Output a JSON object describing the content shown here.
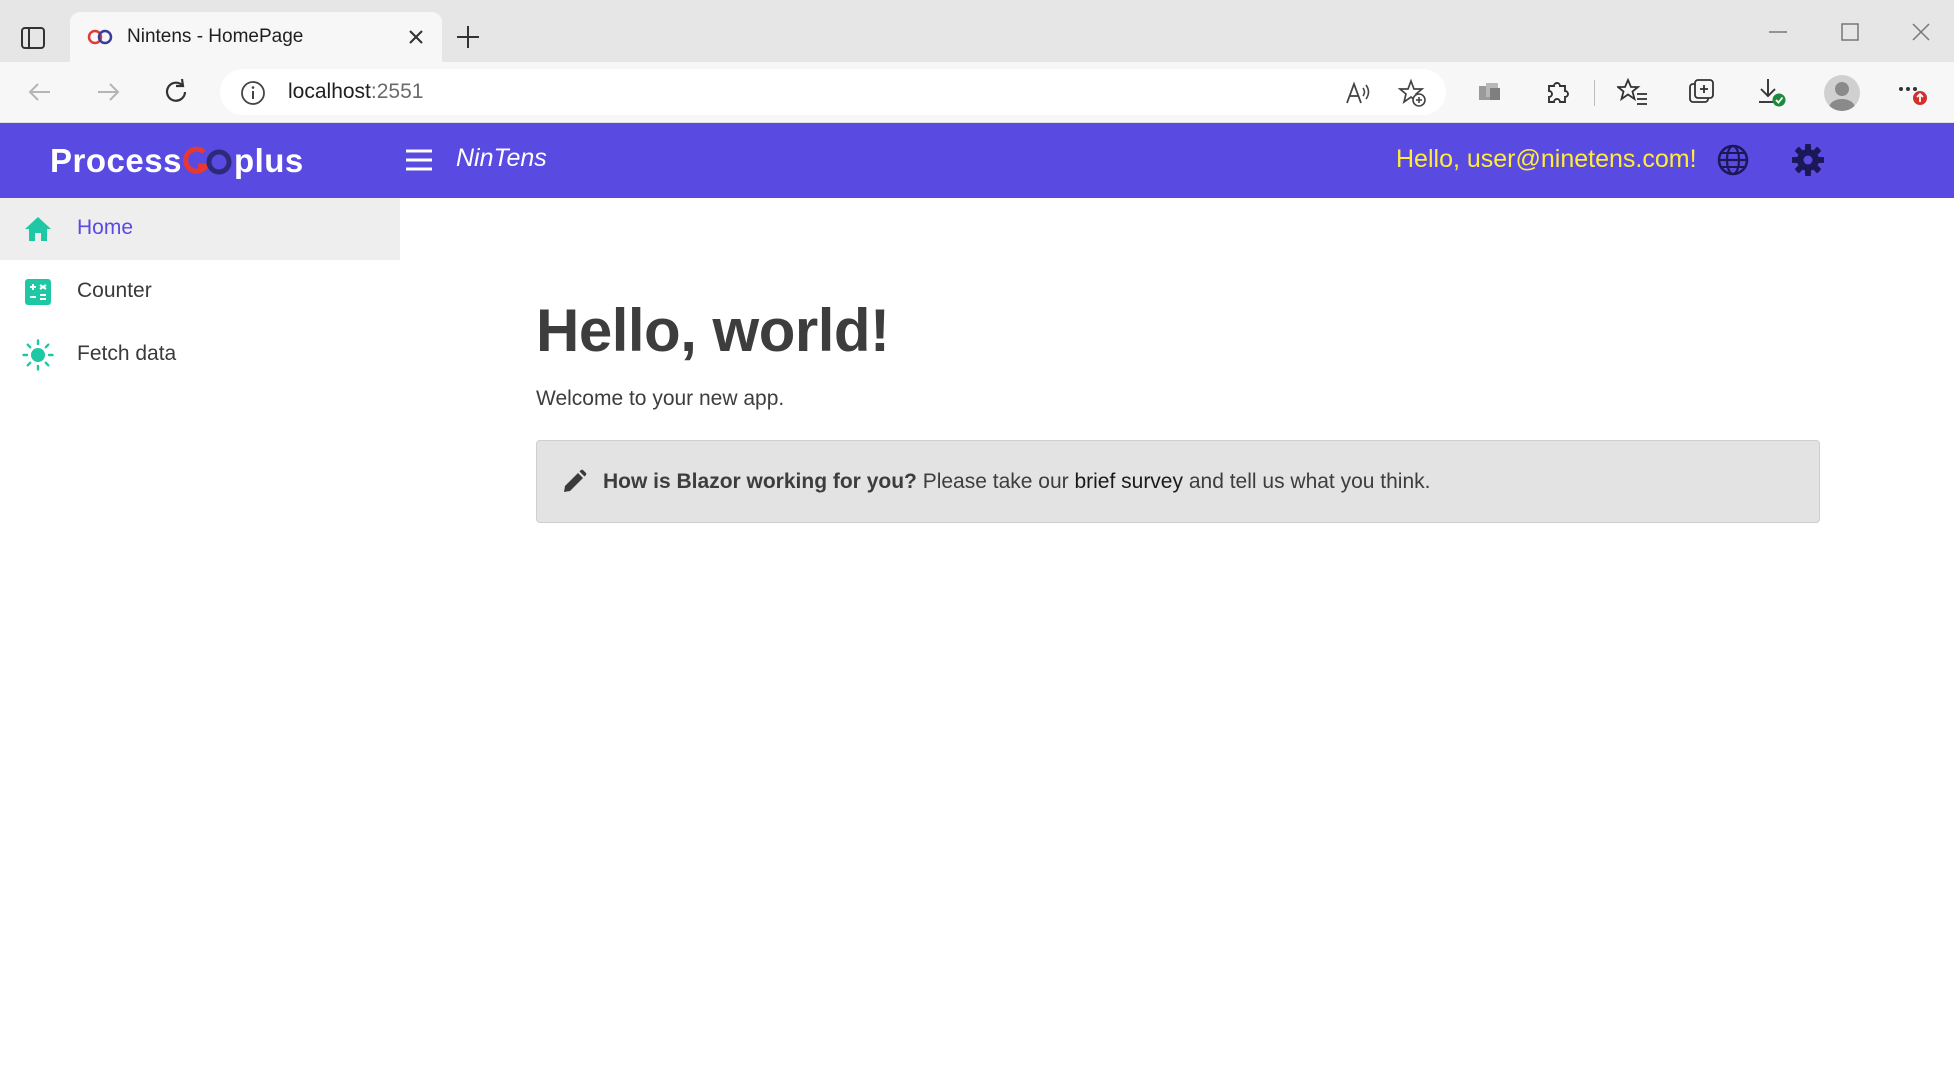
{
  "browser": {
    "tab": {
      "title": "Nintens - HomePage"
    },
    "address": {
      "host": "localhost",
      "port": ":2551"
    }
  },
  "app": {
    "logo": {
      "left": "Process",
      "right": "plus"
    },
    "brand": "NinTens",
    "greeting": "Hello, user@ninetens.com!"
  },
  "sidebar": {
    "items": [
      {
        "label": "Home",
        "icon": "home-icon",
        "active": true
      },
      {
        "label": "Counter",
        "icon": "calculator-icon",
        "active": false
      },
      {
        "label": "Fetch data",
        "icon": "sun-icon",
        "active": false
      }
    ]
  },
  "main": {
    "title": "Hello, world!",
    "welcome": "Welcome to your new app.",
    "survey": {
      "question": "How is Blazor working for you?",
      "before_link": " Please take our ",
      "link": "brief survey",
      "after_link": " and tell us what you think."
    }
  },
  "colors": {
    "appbar": "#594ae2",
    "accent_icon": "#1ec8a5",
    "greeting": "#ffeb3b"
  }
}
